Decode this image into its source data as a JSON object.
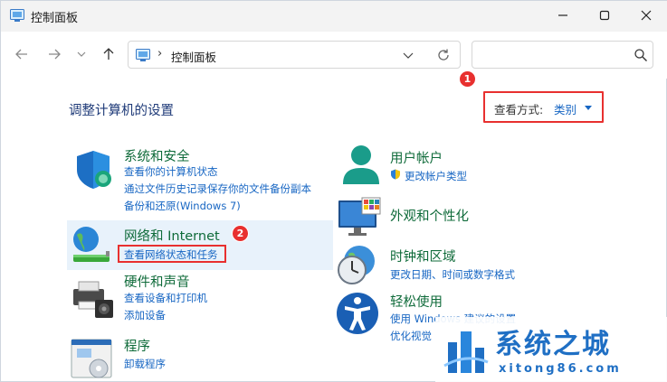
{
  "window": {
    "title": "控制面板"
  },
  "address": {
    "separator": "›",
    "path": "控制面板"
  },
  "search": {
    "placeholder": ""
  },
  "content": {
    "heading": "调整计算机的设置",
    "view_by_label": "查看方式:",
    "view_by_value": "类别"
  },
  "badges": [
    "1",
    "2"
  ],
  "categories_left": [
    {
      "title": "系统和安全",
      "links": [
        "查看你的计算机状态",
        "通过文件历史记录保存你的文件备份副本",
        "备份和还原(Windows 7)"
      ],
      "icon": "shield-icon"
    },
    {
      "title": "网络和 Internet",
      "links": [
        "查看网络状态和任务"
      ],
      "icon": "network-globe-icon"
    },
    {
      "title": "硬件和声音",
      "links": [
        "查看设备和打印机",
        "添加设备"
      ],
      "icon": "printer-speaker-icon"
    },
    {
      "title": "程序",
      "links": [
        "卸载程序"
      ],
      "icon": "programs-disc-icon"
    }
  ],
  "categories_right": [
    {
      "title": "用户帐户",
      "links": [
        "更改帐户类型"
      ],
      "icon": "user-icon"
    },
    {
      "title": "外观和个性化",
      "links": [],
      "icon": "monitor-palette-icon"
    },
    {
      "title": "时钟和区域",
      "links": [
        "更改日期、时间或数字格式"
      ],
      "icon": "clock-globe-icon"
    },
    {
      "title": "轻松使用",
      "links": [
        "使用 Windows 建议的设置",
        "优化视觉"
      ],
      "icon": "accessibility-icon"
    }
  ],
  "watermark": {
    "brand": "系统之城",
    "url": "xitong86.com"
  },
  "colors": {
    "accent_link": "#1766c3",
    "category_green": "#0f6b3a",
    "heading_blue": "#1e3a78",
    "highlight_red": "#e8302f"
  }
}
